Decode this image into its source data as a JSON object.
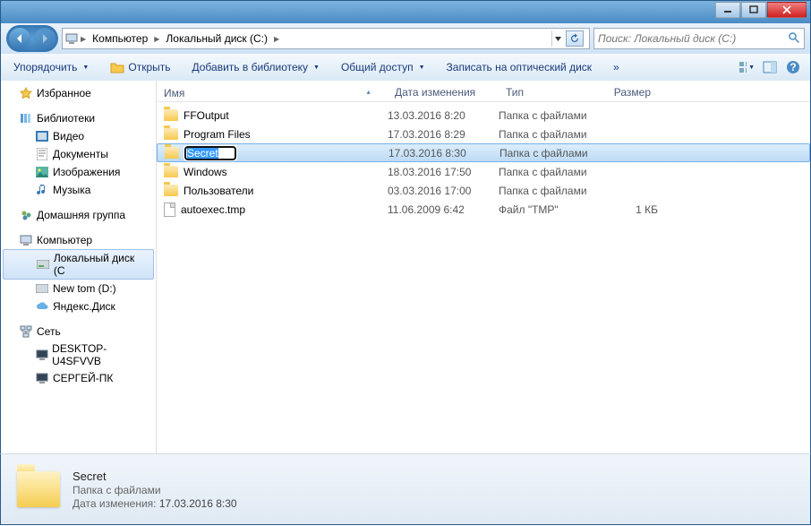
{
  "breadcrumb": {
    "items": [
      "Компьютер",
      "Локальный диск (C:)"
    ]
  },
  "search": {
    "placeholder": "Поиск: Локальный диск (C:)"
  },
  "toolbar": {
    "organize": "Упорядочить",
    "open": "Открыть",
    "addlib": "Добавить в библиотеку",
    "share": "Общий доступ",
    "burn": "Записать на оптический диск",
    "more": "»"
  },
  "sidebar": {
    "favorites": "Избранное",
    "libraries": "Библиотеки",
    "video": "Видео",
    "documents": "Документы",
    "pictures": "Изображения",
    "music": "Музыка",
    "homegroup": "Домашняя группа",
    "computer": "Компьютер",
    "local_c": "Локальный диск (C",
    "new_tom": "New tom (D:)",
    "yadisk": "Яндекс.Диск",
    "network": "Сеть",
    "desktop1": "DESKTOP-U4SFVVB",
    "desktop2": "СЕРГЕЙ-ПК"
  },
  "columns": {
    "name": "Имя",
    "date": "Дата изменения",
    "type": "Тип",
    "size": "Размер"
  },
  "files": [
    {
      "name": "FFOutput",
      "date": "13.03.2016 8:20",
      "type": "Папка с файлами",
      "size": "",
      "kind": "folder"
    },
    {
      "name": "Program Files",
      "date": "17.03.2016 8:29",
      "type": "Папка с файлами",
      "size": "",
      "kind": "folder"
    },
    {
      "name": "Secret",
      "date": "17.03.2016 8:30",
      "type": "Папка с файлами",
      "size": "",
      "kind": "folder",
      "editing": true
    },
    {
      "name": "Windows",
      "date": "18.03.2016 17:50",
      "type": "Папка с файлами",
      "size": "",
      "kind": "folder"
    },
    {
      "name": "Пользователи",
      "date": "03.03.2016 17:00",
      "type": "Папка с файлами",
      "size": "",
      "kind": "folder"
    },
    {
      "name": "autoexec.tmp",
      "date": "11.06.2009 6:42",
      "type": "Файл \"TMP\"",
      "size": "1 КБ",
      "kind": "file"
    }
  ],
  "details": {
    "name": "Secret",
    "type": "Папка с файлами",
    "date_label": "Дата изменения:",
    "date": "17.03.2016 8:30"
  }
}
